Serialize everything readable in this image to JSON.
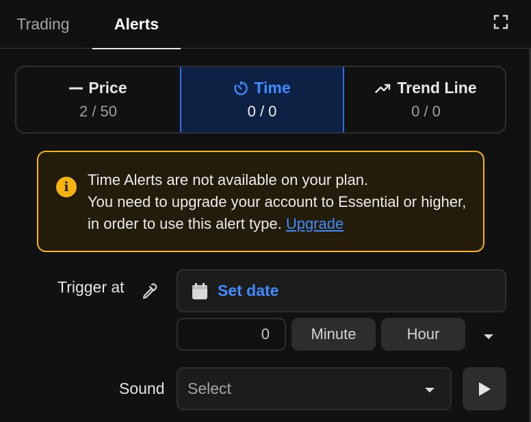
{
  "tabs": {
    "trading": "Trading",
    "alerts": "Alerts",
    "expand_icon": "expand-icon"
  },
  "alert_types": [
    {
      "label": "Price",
      "count": "2 / 50",
      "icon": "dash-icon",
      "selected": false
    },
    {
      "label": "Time",
      "count": "0 / 0",
      "icon": "timer-icon",
      "selected": true
    },
    {
      "label": "Trend Line",
      "count": "0 / 0",
      "icon": "trend-up-icon",
      "selected": false
    }
  ],
  "notice": {
    "line1": "Time Alerts are not available on your plan.",
    "line2": "You need to upgrade your account to Essential or higher, in order to use this alert type.",
    "link": "Upgrade",
    "icon": "info-icon"
  },
  "trigger": {
    "label": "Trigger at",
    "date_placeholder": "Set date",
    "amount": "0",
    "unit_minute": "Minute",
    "unit_hour": "Hour"
  },
  "sound": {
    "label": "Sound",
    "placeholder": "Select"
  },
  "colors": {
    "accent": "#3e8cff",
    "warning": "#f5b40f",
    "background": "#111111"
  }
}
